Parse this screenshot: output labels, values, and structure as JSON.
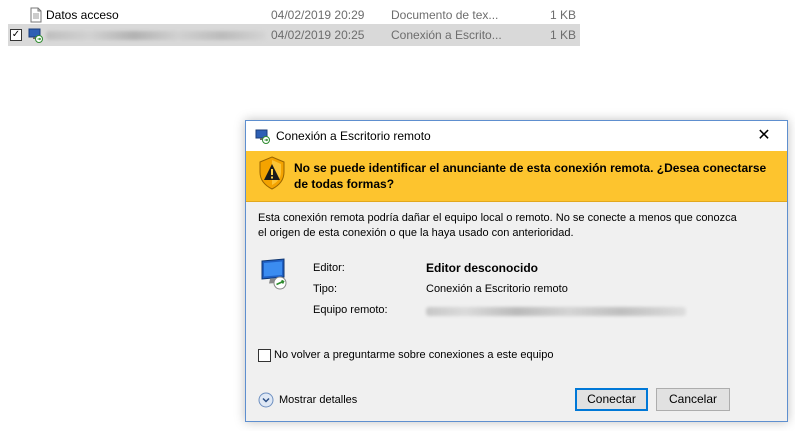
{
  "files": [
    {
      "name": "Datos acceso",
      "date": "04/02/2019 20:29",
      "type": "Documento de tex...",
      "size": "1 KB",
      "selected": false,
      "icon": "text-document-icon"
    },
    {
      "name": "",
      "date": "04/02/2019 20:25",
      "type": "Conexión a Escrito...",
      "size": "1 KB",
      "selected": true,
      "icon": "remote-desktop-icon"
    }
  ],
  "dialog": {
    "title": "Conexión a Escritorio remoto",
    "close_glyph": "✕",
    "warning": "No se puede identificar el anunciante de esta conexión remota. ¿Desea conectarse de todas formas?",
    "description": "Esta conexión remota podría dañar el equipo local o remoto. No se conecte a menos que conozca el origen de esta conexión o que la haya usado con anterioridad.",
    "info": {
      "editor_label": "Editor:",
      "editor_value": "Editor desconocido",
      "type_label": "Tipo:",
      "type_value": "Conexión a Escritorio remoto",
      "remote_label": "Equipo remoto:",
      "remote_value": ""
    },
    "checkbox_label": "No volver a preguntarme sobre conexiones a este equipo",
    "checkbox_checked": false,
    "details_label": "Mostrar detalles",
    "buttons": {
      "connect": "Conectar",
      "cancel": "Cancelar"
    }
  },
  "colors": {
    "warning_bar": "#fdc42e",
    "accent": "#0078d7",
    "selected_row": "#d9d9d9",
    "dialog_bg": "#f0f0f0"
  }
}
